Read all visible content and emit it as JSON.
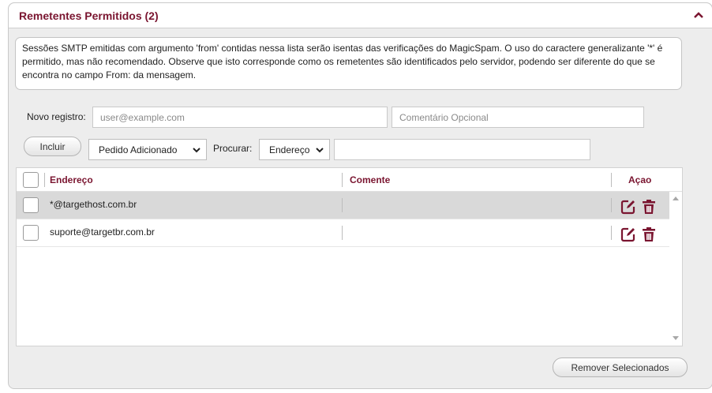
{
  "panel": {
    "title": "Remetentes Permitidos (2)",
    "accent_color": "#7a1530"
  },
  "info_text": "Sessões SMTP emitidas com argumento 'from' contidas nessa lista serão isentas das verificações do MagicSpam. O uso do caractere generalizante '*' é permitido, mas não recomendado. Observe que isto corresponde como os remetentes são identificados pelo servidor, podendo ser diferente do que se encontra no campo From: da mensagem.",
  "form": {
    "new_record_label": "Novo registro:",
    "email_placeholder": "user@example.com",
    "comment_placeholder": "Comentário Opcional",
    "add_button": "Incluir",
    "sort_select": "Pedido Adicionado",
    "search_label": "Procurar:",
    "search_field_select": "Endereço",
    "search_value": ""
  },
  "table": {
    "headers": {
      "address": "Endereço",
      "comment": "Comente",
      "action": "Açao"
    },
    "rows": [
      {
        "address": "*@targethost.com.br",
        "comment": "",
        "selected": true
      },
      {
        "address": "suporte@targetbr.com.br",
        "comment": "",
        "selected": false
      }
    ]
  },
  "remove_button": "Remover Selecionados",
  "icons": {
    "collapse": "chevron-up-icon",
    "edit": "edit-icon",
    "delete": "trash-icon",
    "dropdown": "chevron-down-icon"
  }
}
